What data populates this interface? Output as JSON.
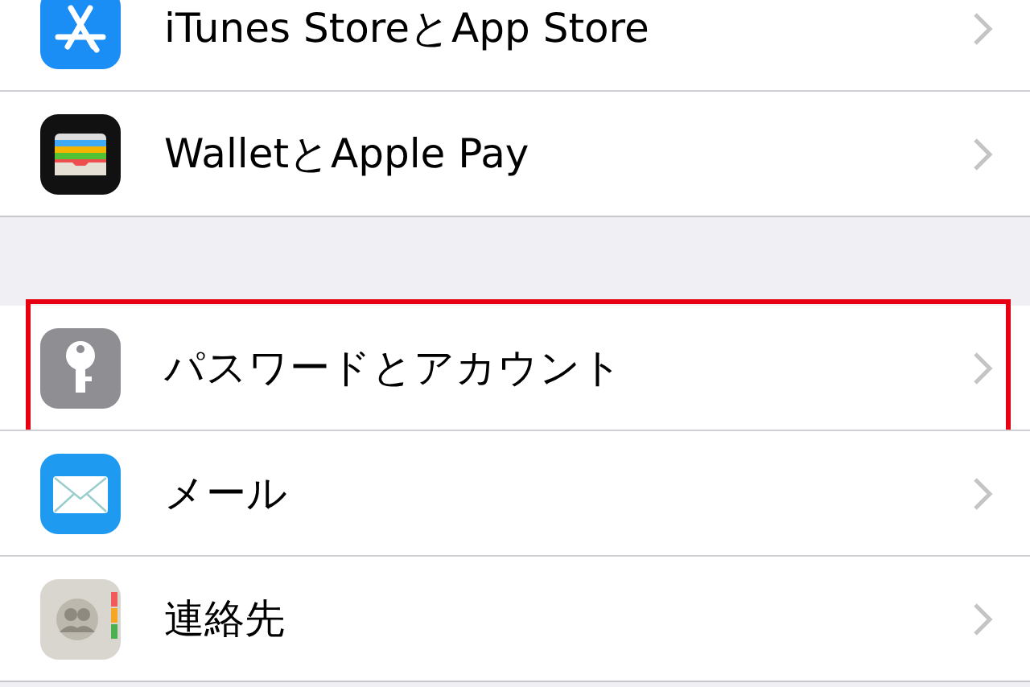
{
  "groups": [
    {
      "rows": [
        {
          "kind": "appstore",
          "label": "iTunes StoreとApp Store",
          "highlighted": false
        },
        {
          "kind": "wallet",
          "label": "WalletとApple Pay",
          "highlighted": false
        }
      ]
    },
    {
      "rows": [
        {
          "kind": "key",
          "label": "パスワードとアカウント",
          "highlighted": true
        },
        {
          "kind": "mail",
          "label": "メール",
          "highlighted": false
        },
        {
          "kind": "contacts",
          "label": "連絡先",
          "highlighted": false
        }
      ]
    }
  ]
}
